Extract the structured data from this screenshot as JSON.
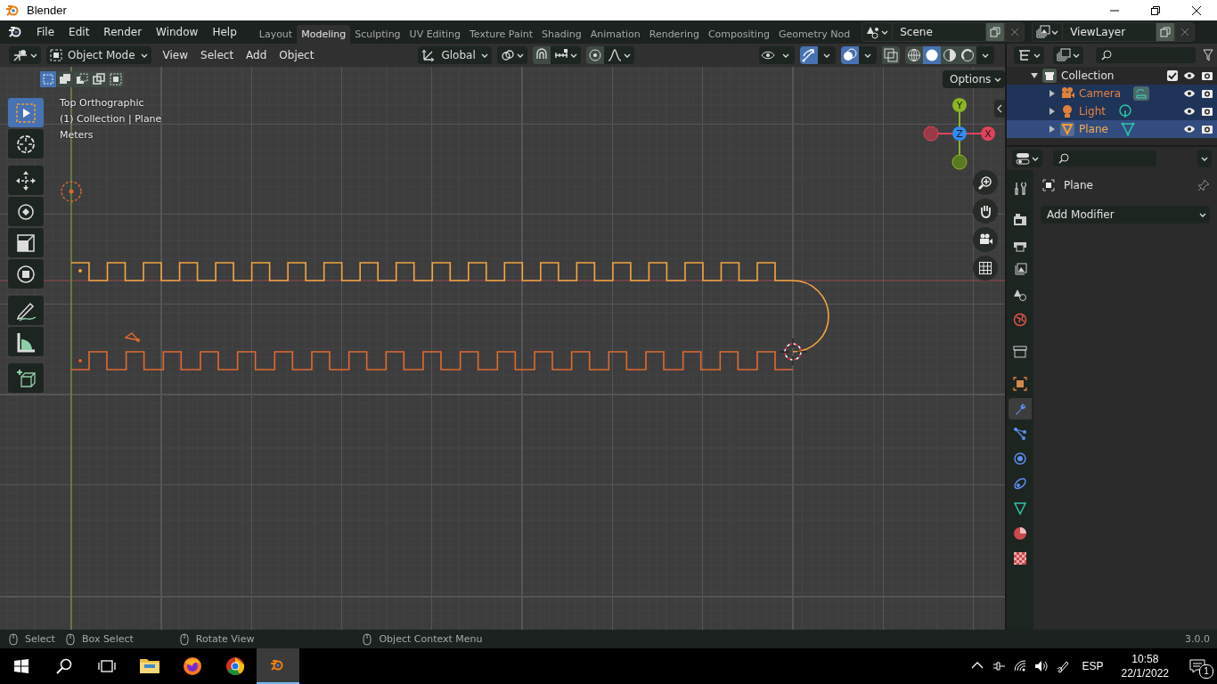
{
  "window": {
    "title": "Blender"
  },
  "menu": [
    "File",
    "Edit",
    "Render",
    "Window",
    "Help"
  ],
  "workspaces": [
    {
      "label": "Layout",
      "selected": false
    },
    {
      "label": "Modeling",
      "selected": true
    },
    {
      "label": "Sculpting",
      "selected": false
    },
    {
      "label": "UV Editing",
      "selected": false
    },
    {
      "label": "Texture Paint",
      "selected": false
    },
    {
      "label": "Shading",
      "selected": false
    },
    {
      "label": "Animation",
      "selected": false
    },
    {
      "label": "Rendering",
      "selected": false
    },
    {
      "label": "Compositing",
      "selected": false
    },
    {
      "label": "Geometry Nod",
      "selected": false
    }
  ],
  "scene": {
    "name": "Scene"
  },
  "view_layer": {
    "name": "ViewLayer"
  },
  "viewport_header": {
    "mode": "Object Mode",
    "menus": [
      "View",
      "Select",
      "Add",
      "Object"
    ],
    "orientation": "Global",
    "left_toggles": [
      {
        "kind": "snap",
        "on": false
      },
      {
        "kind": "proportional",
        "on": false
      }
    ],
    "right_toggles": [
      {
        "kind": "visibility",
        "on": false
      },
      {
        "kind": "gizmo",
        "on": true
      },
      {
        "kind": "overlay",
        "on": true
      },
      {
        "kind": "xray",
        "on": false
      }
    ],
    "shading": [
      {
        "kind": "wireframe",
        "selected": false
      },
      {
        "kind": "solid",
        "selected": true
      },
      {
        "kind": "material",
        "selected": false
      },
      {
        "kind": "rendered",
        "selected": false
      }
    ]
  },
  "select_modes": [
    {
      "kind": "set",
      "selected": true
    },
    {
      "kind": "extend",
      "selected": false
    },
    {
      "kind": "subtract",
      "selected": false
    },
    {
      "kind": "difference",
      "selected": false
    },
    {
      "kind": "intersect",
      "selected": false
    }
  ],
  "options": "Options",
  "viewport_info": [
    "Top Orthographic",
    "(1) Collection | Plane",
    "Meters"
  ],
  "tools": [
    {
      "kind": "select_box",
      "selected": true
    },
    {
      "kind": "cursor",
      "selected": false
    },
    {
      "kind": "move",
      "selected": false
    },
    {
      "kind": "rotate",
      "selected": false
    },
    {
      "kind": "scale",
      "selected": false
    },
    {
      "kind": "transform",
      "selected": false
    },
    {
      "kind": "annotate",
      "selected": false
    },
    {
      "kind": "measure",
      "selected": false
    },
    {
      "kind": "add_cube",
      "selected": false
    }
  ],
  "nav_gizmo": {
    "x": "X",
    "y": "Y",
    "z": "Z"
  },
  "outliner": {
    "collection": {
      "name": "Collection",
      "checked": true,
      "expanded": true,
      "children": [
        {
          "name": "Camera",
          "kind": "camera",
          "selected": true,
          "active": false
        },
        {
          "name": "Light",
          "kind": "light",
          "selected": true,
          "active": false
        },
        {
          "name": "Plane",
          "kind": "mesh",
          "selected": true,
          "active": true
        }
      ]
    }
  },
  "properties": {
    "object": "Plane",
    "add_modifier": "Add Modifier",
    "tabs": [
      {
        "kind": "tool",
        "selected": false
      },
      {
        "kind": "render",
        "selected": false
      },
      {
        "kind": "output",
        "selected": false
      },
      {
        "kind": "view_layer",
        "selected": false
      },
      {
        "kind": "scene",
        "selected": false
      },
      {
        "kind": "world",
        "selected": false
      },
      {
        "kind": "collection",
        "selected": false
      },
      {
        "kind": "object",
        "selected": false
      },
      {
        "kind": "modifiers",
        "selected": true
      },
      {
        "kind": "particles",
        "selected": false
      },
      {
        "kind": "physics",
        "selected": false
      },
      {
        "kind": "constraints",
        "selected": false
      },
      {
        "kind": "data",
        "selected": false
      },
      {
        "kind": "material",
        "selected": false
      },
      {
        "kind": "texture",
        "selected": false
      }
    ]
  },
  "status_bar": {
    "hints": [
      "Select",
      "Box Select",
      "Rotate View",
      "Object Context Menu"
    ],
    "version": "3.0.0"
  },
  "taskbar": {
    "apps": [
      {
        "kind": "explorer",
        "selected": false
      },
      {
        "kind": "firefox",
        "selected": false
      },
      {
        "kind": "chrome",
        "selected": false
      },
      {
        "kind": "blender",
        "selected": true
      }
    ],
    "language": "ESP",
    "time": "10:58",
    "date": "22/1/2022",
    "notifications": "1"
  }
}
